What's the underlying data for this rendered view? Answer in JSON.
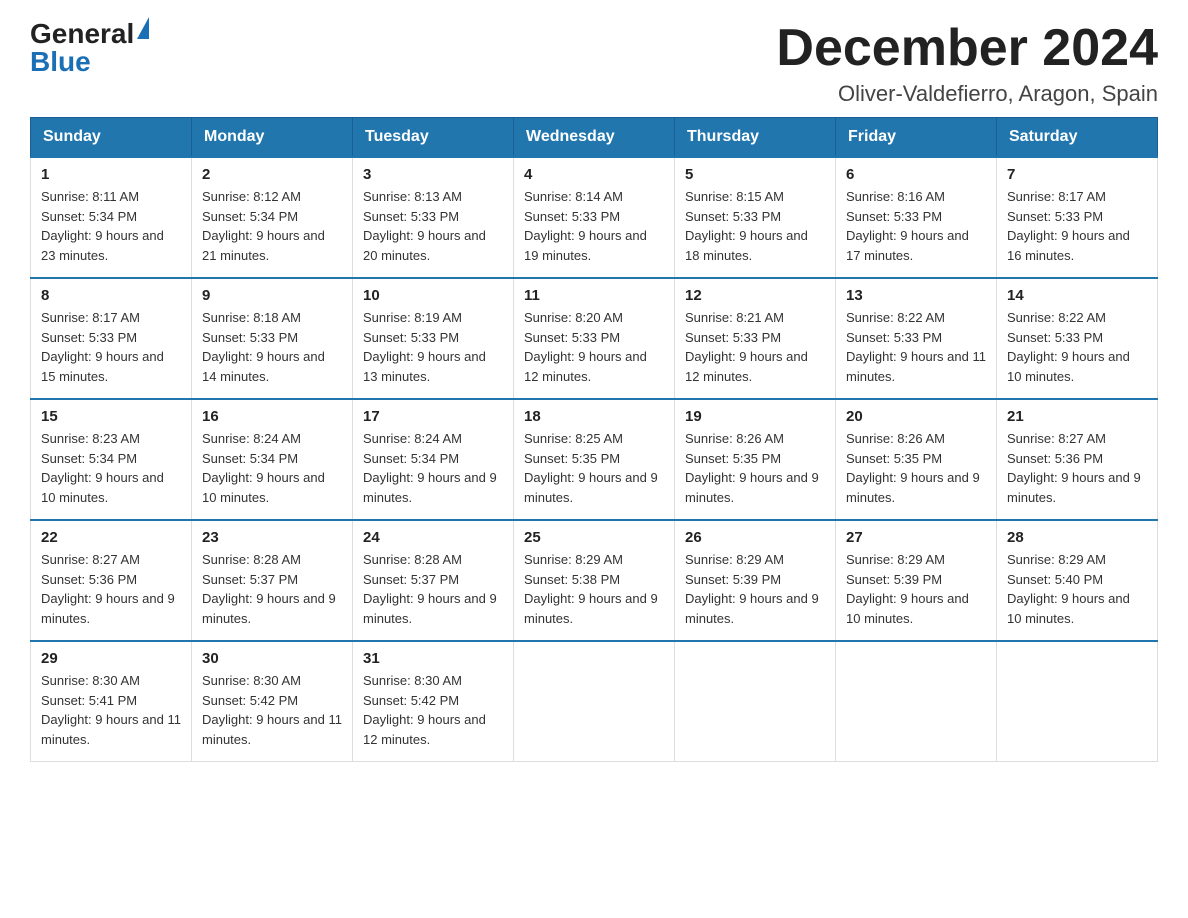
{
  "header": {
    "logo_general": "General",
    "logo_blue": "Blue",
    "month_title": "December 2024",
    "location": "Oliver-Valdefierro, Aragon, Spain"
  },
  "weekdays": [
    "Sunday",
    "Monday",
    "Tuesday",
    "Wednesday",
    "Thursday",
    "Friday",
    "Saturday"
  ],
  "weeks": [
    [
      {
        "day": "1",
        "sunrise": "8:11 AM",
        "sunset": "5:34 PM",
        "daylight": "9 hours and 23 minutes."
      },
      {
        "day": "2",
        "sunrise": "8:12 AM",
        "sunset": "5:34 PM",
        "daylight": "9 hours and 21 minutes."
      },
      {
        "day": "3",
        "sunrise": "8:13 AM",
        "sunset": "5:33 PM",
        "daylight": "9 hours and 20 minutes."
      },
      {
        "day": "4",
        "sunrise": "8:14 AM",
        "sunset": "5:33 PM",
        "daylight": "9 hours and 19 minutes."
      },
      {
        "day": "5",
        "sunrise": "8:15 AM",
        "sunset": "5:33 PM",
        "daylight": "9 hours and 18 minutes."
      },
      {
        "day": "6",
        "sunrise": "8:16 AM",
        "sunset": "5:33 PM",
        "daylight": "9 hours and 17 minutes."
      },
      {
        "day": "7",
        "sunrise": "8:17 AM",
        "sunset": "5:33 PM",
        "daylight": "9 hours and 16 minutes."
      }
    ],
    [
      {
        "day": "8",
        "sunrise": "8:17 AM",
        "sunset": "5:33 PM",
        "daylight": "9 hours and 15 minutes."
      },
      {
        "day": "9",
        "sunrise": "8:18 AM",
        "sunset": "5:33 PM",
        "daylight": "9 hours and 14 minutes."
      },
      {
        "day": "10",
        "sunrise": "8:19 AM",
        "sunset": "5:33 PM",
        "daylight": "9 hours and 13 minutes."
      },
      {
        "day": "11",
        "sunrise": "8:20 AM",
        "sunset": "5:33 PM",
        "daylight": "9 hours and 12 minutes."
      },
      {
        "day": "12",
        "sunrise": "8:21 AM",
        "sunset": "5:33 PM",
        "daylight": "9 hours and 12 minutes."
      },
      {
        "day": "13",
        "sunrise": "8:22 AM",
        "sunset": "5:33 PM",
        "daylight": "9 hours and 11 minutes."
      },
      {
        "day": "14",
        "sunrise": "8:22 AM",
        "sunset": "5:33 PM",
        "daylight": "9 hours and 10 minutes."
      }
    ],
    [
      {
        "day": "15",
        "sunrise": "8:23 AM",
        "sunset": "5:34 PM",
        "daylight": "9 hours and 10 minutes."
      },
      {
        "day": "16",
        "sunrise": "8:24 AM",
        "sunset": "5:34 PM",
        "daylight": "9 hours and 10 minutes."
      },
      {
        "day": "17",
        "sunrise": "8:24 AM",
        "sunset": "5:34 PM",
        "daylight": "9 hours and 9 minutes."
      },
      {
        "day": "18",
        "sunrise": "8:25 AM",
        "sunset": "5:35 PM",
        "daylight": "9 hours and 9 minutes."
      },
      {
        "day": "19",
        "sunrise": "8:26 AM",
        "sunset": "5:35 PM",
        "daylight": "9 hours and 9 minutes."
      },
      {
        "day": "20",
        "sunrise": "8:26 AM",
        "sunset": "5:35 PM",
        "daylight": "9 hours and 9 minutes."
      },
      {
        "day": "21",
        "sunrise": "8:27 AM",
        "sunset": "5:36 PM",
        "daylight": "9 hours and 9 minutes."
      }
    ],
    [
      {
        "day": "22",
        "sunrise": "8:27 AM",
        "sunset": "5:36 PM",
        "daylight": "9 hours and 9 minutes."
      },
      {
        "day": "23",
        "sunrise": "8:28 AM",
        "sunset": "5:37 PM",
        "daylight": "9 hours and 9 minutes."
      },
      {
        "day": "24",
        "sunrise": "8:28 AM",
        "sunset": "5:37 PM",
        "daylight": "9 hours and 9 minutes."
      },
      {
        "day": "25",
        "sunrise": "8:29 AM",
        "sunset": "5:38 PM",
        "daylight": "9 hours and 9 minutes."
      },
      {
        "day": "26",
        "sunrise": "8:29 AM",
        "sunset": "5:39 PM",
        "daylight": "9 hours and 9 minutes."
      },
      {
        "day": "27",
        "sunrise": "8:29 AM",
        "sunset": "5:39 PM",
        "daylight": "9 hours and 10 minutes."
      },
      {
        "day": "28",
        "sunrise": "8:29 AM",
        "sunset": "5:40 PM",
        "daylight": "9 hours and 10 minutes."
      }
    ],
    [
      {
        "day": "29",
        "sunrise": "8:30 AM",
        "sunset": "5:41 PM",
        "daylight": "9 hours and 11 minutes."
      },
      {
        "day": "30",
        "sunrise": "8:30 AM",
        "sunset": "5:42 PM",
        "daylight": "9 hours and 11 minutes."
      },
      {
        "day": "31",
        "sunrise": "8:30 AM",
        "sunset": "5:42 PM",
        "daylight": "9 hours and 12 minutes."
      },
      null,
      null,
      null,
      null
    ]
  ]
}
